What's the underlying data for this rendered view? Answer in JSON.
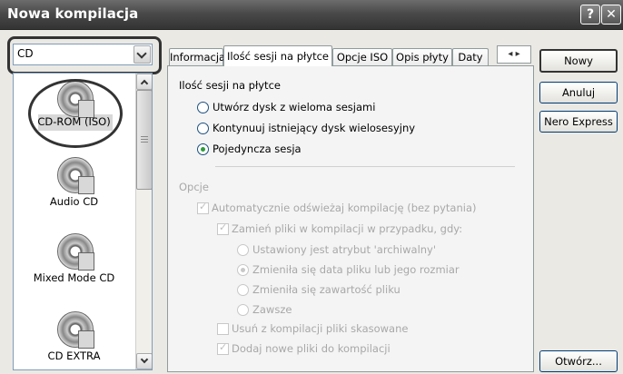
{
  "window": {
    "title": "Nowa kompilacja",
    "help_glyph": "?",
    "close_glyph": "✕"
  },
  "left": {
    "combo_value": "CD",
    "types": [
      {
        "label": "CD-ROM (ISO)",
        "icon": "cd-rom-icon",
        "selected": true
      },
      {
        "label": "Audio CD",
        "icon": "audio-cd-icon",
        "selected": false
      },
      {
        "label": "Mixed Mode CD",
        "icon": "mixed-mode-cd-icon",
        "selected": false
      },
      {
        "label": "CD EXTRA",
        "icon": "cd-extra-icon",
        "selected": false
      }
    ]
  },
  "tabs": {
    "items": [
      "Informacja",
      "Ilość sesji na płytce",
      "Opcje ISO",
      "Opis płyty",
      "Daty"
    ],
    "active": "Ilość sesji na płytce",
    "scroll_glyph": "◂ ▸"
  },
  "sessions": {
    "heading": "Ilość sesji na płytce",
    "options": [
      {
        "label": "Utwórz dysk z wieloma sesjami",
        "checked": false
      },
      {
        "label": "Kontynuuj istniejący dysk wielosesyjny",
        "checked": false
      },
      {
        "label": "Pojedyncza sesja",
        "checked": true
      }
    ]
  },
  "options": {
    "label": "Opcje",
    "auto_refresh": "Automatycznie odświeżaj kompilację (bez pytania)",
    "replace_files": "Zamień pliki w kompilacji w przypadku, gdy:",
    "archive_attr": "Ustawiony jest atrybut 'archiwalny'",
    "date_or_size": "Zmieniła się data pliku lub jego rozmiar",
    "content_changed": "Zmieniła się zawartość pliku",
    "always": "Zawsze",
    "remove_deleted": "Usuń z kompilacji pliki skasowane",
    "add_new": "Dodaj nowe pliki do kompilacji"
  },
  "buttons": {
    "new": "Nowy",
    "cancel": "Anuluj",
    "nero_express": "Nero Express",
    "open": "Otwórz..."
  }
}
